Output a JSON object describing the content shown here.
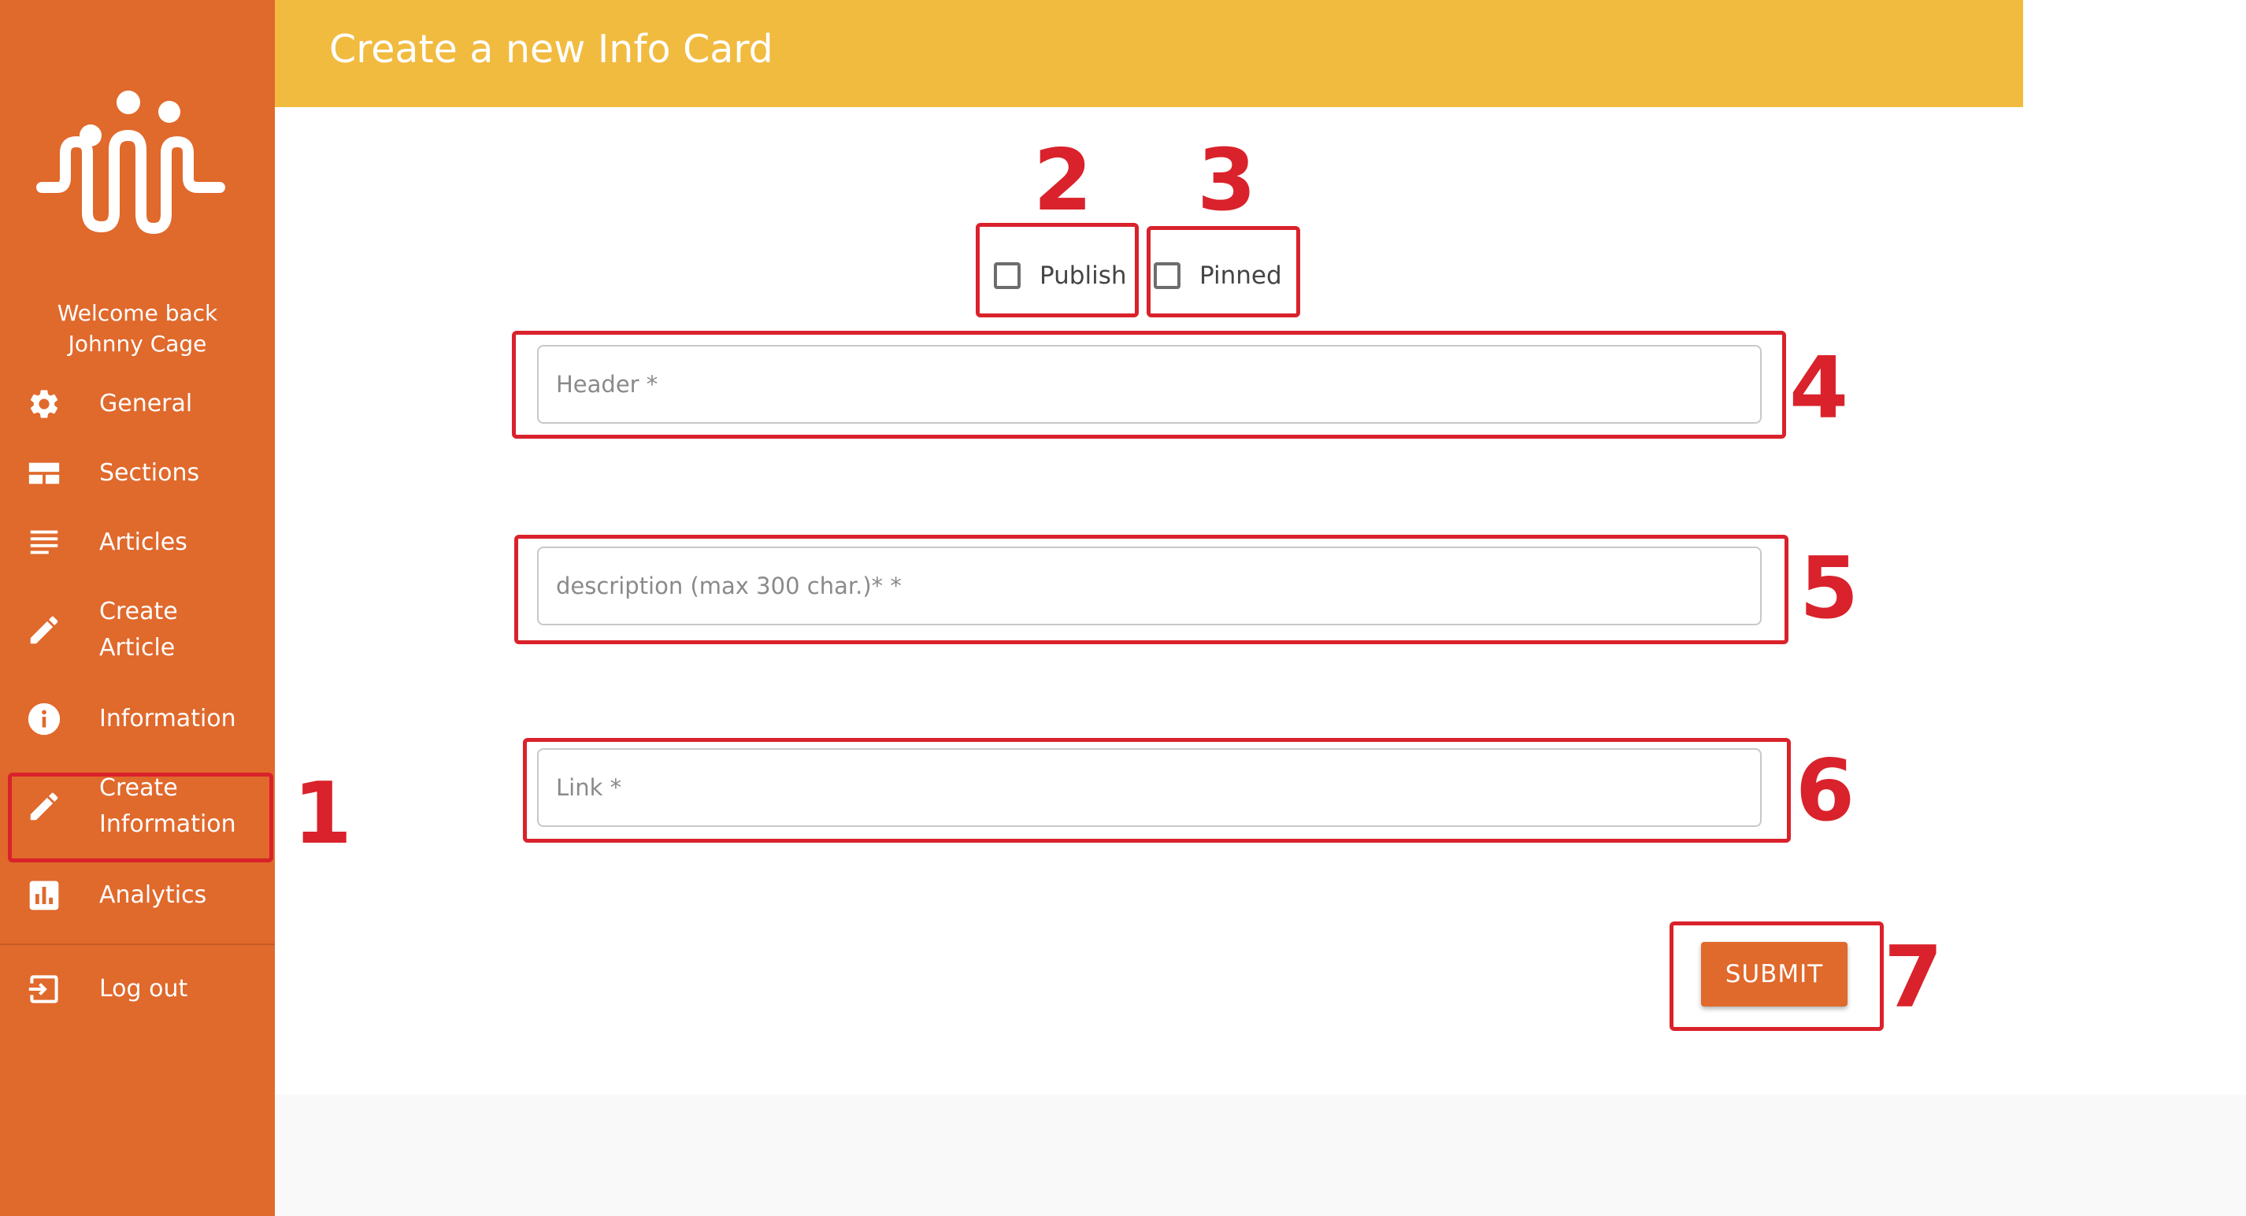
{
  "sidebar": {
    "logo_icon": "people-wave-logo",
    "welcome_line1": "Welcome back",
    "welcome_line2": "Johnny Cage",
    "items": [
      {
        "label": "General",
        "icon": "gear-icon"
      },
      {
        "label": "Sections",
        "icon": "sections-icon"
      },
      {
        "label": "Articles",
        "icon": "list-icon"
      },
      {
        "label_line1": "Create",
        "label_line2": "Article",
        "icon": "pencil-icon"
      },
      {
        "label": "Information",
        "icon": "info-icon"
      },
      {
        "label_line1": "Create",
        "label_line2": "Information",
        "icon": "pencil-icon"
      },
      {
        "label": "Analytics",
        "icon": "bar-chart-icon"
      },
      {
        "label": "Log out",
        "icon": "logout-icon"
      }
    ]
  },
  "header": {
    "title": "Create a new Info Card"
  },
  "form": {
    "publish_label": "Publish",
    "pinned_label": "Pinned",
    "header_placeholder": "Header *",
    "description_placeholder": "description (max 300 char.)* *",
    "link_placeholder": "Link *",
    "submit_label": "SUBMIT"
  },
  "annotations": [
    "1",
    "2",
    "3",
    "4",
    "5",
    "6",
    "7"
  ],
  "colors": {
    "sidebar": "#e0692c",
    "header": "#f1bb40",
    "annotation": "#d9222b",
    "submit": "#e0692c"
  }
}
